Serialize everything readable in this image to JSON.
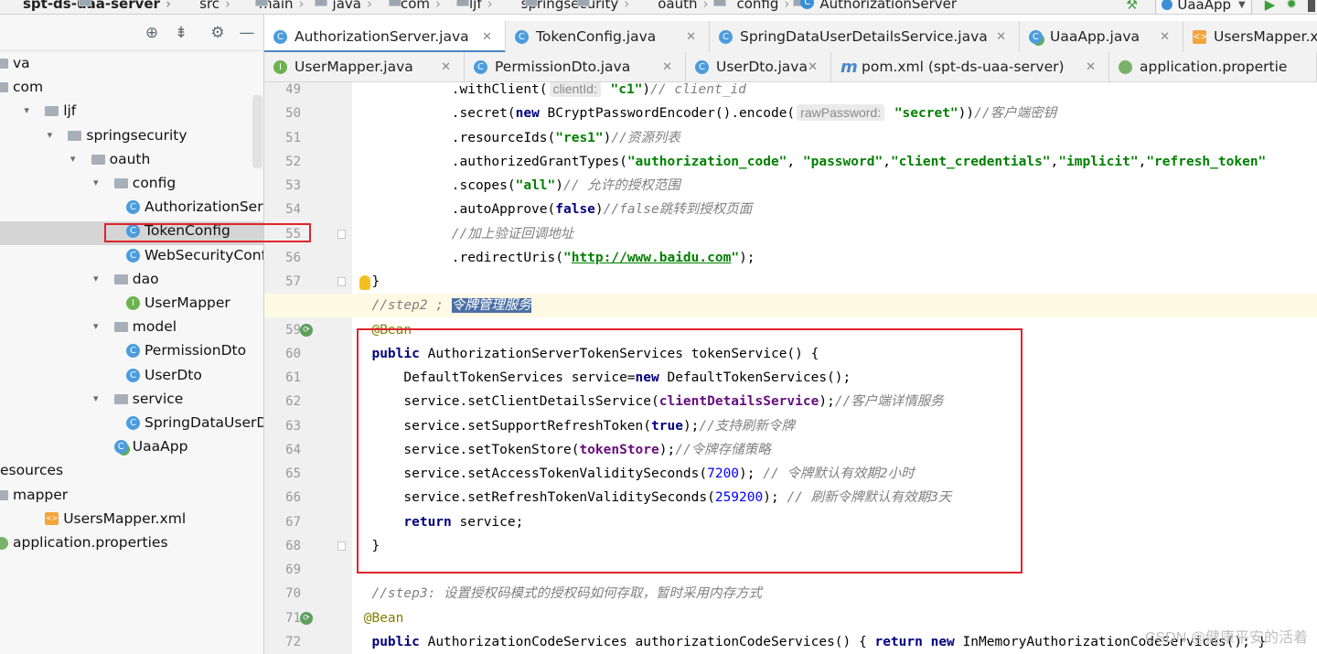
{
  "breadcrumb": [
    "spt-ds-uaa-server",
    "src",
    "main",
    "java",
    "com",
    "ljf",
    "springsecurity",
    "oauth",
    "config",
    "AuthorizationServer"
  ],
  "run_config": "UaaApp",
  "project_tree": [
    {
      "label": "va",
      "indent": 0,
      "kind": "folder",
      "arrow": ""
    },
    {
      "label": "com",
      "indent": 0,
      "kind": "folder",
      "arrow": ""
    },
    {
      "label": "ljf",
      "indent": 1,
      "kind": "folder",
      "arrow": "▾"
    },
    {
      "label": "springsecurity",
      "indent": 2,
      "kind": "folder",
      "arrow": "▾"
    },
    {
      "label": "oauth",
      "indent": 3,
      "kind": "folder",
      "arrow": "▾"
    },
    {
      "label": "config",
      "indent": 4,
      "kind": "folder",
      "arrow": "▾"
    },
    {
      "label": "AuthorizationServer",
      "indent": 5,
      "kind": "class",
      "arrow": ""
    },
    {
      "label": "TokenConfig",
      "indent": 5,
      "kind": "class",
      "arrow": ""
    },
    {
      "label": "WebSecurityConfig",
      "indent": 5,
      "kind": "class",
      "arrow": ""
    },
    {
      "label": "dao",
      "indent": 4,
      "kind": "folder",
      "arrow": "▾"
    },
    {
      "label": "UserMapper",
      "indent": 5,
      "kind": "iface",
      "arrow": ""
    },
    {
      "label": "model",
      "indent": 4,
      "kind": "folder",
      "arrow": "▾"
    },
    {
      "label": "PermissionDto",
      "indent": 5,
      "kind": "class",
      "arrow": ""
    },
    {
      "label": "UserDto",
      "indent": 5,
      "kind": "class",
      "arrow": ""
    },
    {
      "label": "service",
      "indent": 4,
      "kind": "folder",
      "arrow": "▾"
    },
    {
      "label": "SpringDataUserDetai",
      "indent": 5,
      "kind": "class",
      "arrow": ""
    },
    {
      "label": "UaaApp",
      "indent": 4,
      "kind": "app",
      "arrow": ""
    },
    {
      "label": "esources",
      "indent": 0,
      "kind": "none",
      "arrow": ""
    },
    {
      "label": "mapper",
      "indent": 0,
      "kind": "folder",
      "arrow": ""
    },
    {
      "label": "UsersMapper.xml",
      "indent": 1,
      "kind": "xml",
      "arrow": ""
    },
    {
      "label": "application.properties",
      "indent": 0,
      "kind": "props",
      "arrow": ""
    }
  ],
  "tabs_row1": [
    {
      "label": "AuthorizationServer.java",
      "icon": "c",
      "active": true
    },
    {
      "label": "TokenConfig.java",
      "icon": "c",
      "active": false
    },
    {
      "label": "SpringDataUserDetailsService.java",
      "icon": "c",
      "active": false
    },
    {
      "label": "UaaApp.java",
      "icon": "a",
      "active": false
    },
    {
      "label": "UsersMapper.xm",
      "icon": "x",
      "active": false
    }
  ],
  "tabs_row2": [
    {
      "label": "UserMapper.java",
      "icon": "i"
    },
    {
      "label": "PermissionDto.java",
      "icon": "c"
    },
    {
      "label": "UserDto.java",
      "icon": "c"
    },
    {
      "label": "pom.xml (spt-ds-uaa-server)",
      "icon": "m"
    },
    {
      "label": "application.propertie",
      "icon": "p"
    }
  ],
  "code_lines": [
    {
      "n": 49,
      "html": "            .withClient(<span class=\"hint\">clientId:</span> <span class=\"str\">\"c1\"</span>)<span class=\"cmt\">// client_id</span>"
    },
    {
      "n": 50,
      "html": "            .secret(<span class=\"kw\">new</span> BCryptPasswordEncoder().encode(<span class=\"hint\">rawPassword:</span> <span class=\"str\">\"secret\"</span>))<span class=\"cmt\">//客户端密钥</span>"
    },
    {
      "n": 51,
      "html": "            .resourceIds(<span class=\"str\">\"res1\"</span>)<span class=\"cmt\">//资源列表</span>"
    },
    {
      "n": 52,
      "html": "            .authorizedGrantTypes(<span class=\"str\">\"authorization_code\"</span>, <span class=\"str\">\"password\"</span>,<span class=\"str\">\"client_credentials\"</span>,<span class=\"str\">\"implicit\"</span>,<span class=\"str\">\"refresh_token\"</span>"
    },
    {
      "n": 53,
      "html": "            .scopes(<span class=\"str\">\"all\"</span>)<span class=\"cmt\">// 允许的授权范围</span>"
    },
    {
      "n": 54,
      "html": "            .autoApprove(<span class=\"kw\">false</span>)<span class=\"cmt\">//false跳转到授权页面</span>"
    },
    {
      "n": 55,
      "html": "            <span class=\"cmt\">//加上验证回调地址</span>"
    },
    {
      "n": 56,
      "html": "            .redirectUris(<span class=\"str\">\"<u>http://www.baidu.com</u>\"</span>);"
    },
    {
      "n": 57,
      "html": "  }"
    },
    {
      "n": 58,
      "html": "  <span class=\"cmt\">//step2 ; </span><span class=\"selword\">令牌管理服务</span>"
    },
    {
      "n": 59,
      "html": "  <span class=\"ann\">@Bean</span>"
    },
    {
      "n": 60,
      "html": "  <span class=\"kw\">public</span> AuthorizationServerTokenServices tokenService() {"
    },
    {
      "n": 61,
      "html": "      DefaultTokenServices service=<span class=\"kw\">new</span> DefaultTokenServices();"
    },
    {
      "n": 62,
      "html": "      service.setClientDetailsService(<span class=\"fld\">clientDetailsService</span>);<span class=\"cmt\">//客户端详情服务</span>"
    },
    {
      "n": 63,
      "html": "      service.setSupportRefreshToken(<span class=\"kw\">true</span>);<span class=\"cmt\">//支持刷新令牌</span>"
    },
    {
      "n": 64,
      "html": "      service.setTokenStore(<span class=\"fld\">tokenStore</span>);<span class=\"cmt\">//令牌存储策略</span>"
    },
    {
      "n": 65,
      "html": "      service.setAccessTokenValiditySeconds(<span class=\"num\">7200</span>); <span class=\"cmt\">// 令牌默认有效期2小时</span>"
    },
    {
      "n": 66,
      "html": "      service.setRefreshTokenValiditySeconds(<span class=\"num\">259200</span>); <span class=\"cmt\">// 刷新令牌默认有效期3天</span>"
    },
    {
      "n": 67,
      "html": "      <span class=\"kw\">return</span> service;"
    },
    {
      "n": 68,
      "html": "  }"
    },
    {
      "n": 69,
      "html": ""
    },
    {
      "n": 70,
      "html": "  <span class=\"cmt\">//step3: 设置授权码模式的授权码如何存取，暂时采用内存方式</span>"
    },
    {
      "n": 71,
      "html": " <span class=\"ann\">@Bean</span>"
    },
    {
      "n": 72,
      "html": "  <span class=\"kw\">public</span> AuthorizationCodeServices authorizationCodeServices() { <span class=\"kw\">return</span> <span class=\"kw\">new</span> InMemoryAuthorizationCodeServices(); }"
    }
  ],
  "watermark": "CSDN @健康平安的活着",
  "colors": {
    "accent": "#4a86c8",
    "highlight_box": "#e0242b",
    "selection": "#d5d5d5"
  }
}
